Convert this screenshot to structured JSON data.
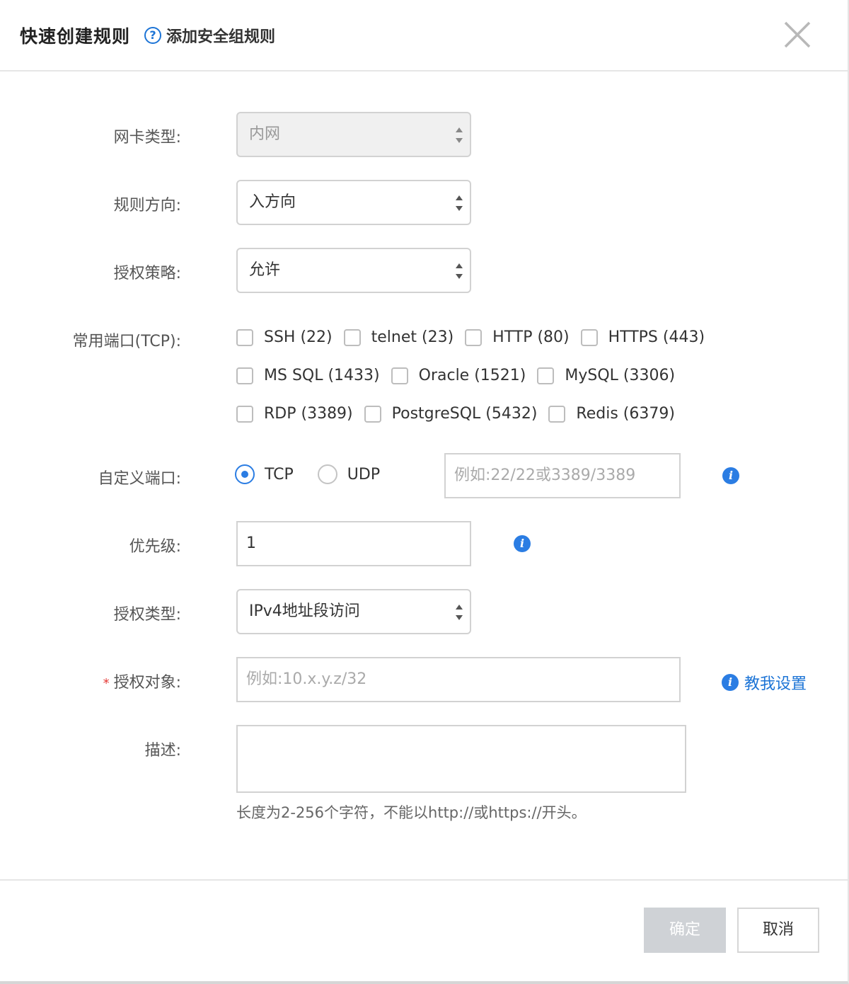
{
  "header": {
    "title": "快速创建规则",
    "help_text": "添加安全组规则"
  },
  "form": {
    "nic_type": {
      "label": "网卡类型:",
      "value": "内网",
      "disabled": true
    },
    "direction": {
      "label": "规则方向:",
      "value": "入方向"
    },
    "policy": {
      "label": "授权策略:",
      "value": "允许"
    },
    "common_ports": {
      "label": "常用端口(TCP):",
      "rows": [
        [
          "SSH (22)",
          "telnet (23)",
          "HTTP (80)",
          "HTTPS (443)"
        ],
        [
          "MS SQL (1433)",
          "Oracle (1521)",
          "MySQL (3306)"
        ],
        [
          "RDP (3389)",
          "PostgreSQL (5432)",
          "Redis (6379)"
        ]
      ]
    },
    "custom_port": {
      "label": "自定义端口:",
      "protocols": [
        "TCP",
        "UDP"
      ],
      "selected": "TCP",
      "placeholder": "例如:22/22或3389/3389"
    },
    "priority": {
      "label": "优先级:",
      "value": "1"
    },
    "auth_type": {
      "label": "授权类型:",
      "value": "IPv4地址段访问"
    },
    "auth_object": {
      "label": "授权对象:",
      "required_mark": "*",
      "placeholder": "例如:10.x.y.z/32",
      "help_link": "教我设置"
    },
    "description": {
      "label": "描述:",
      "hint": "长度为2-256个字符，不能以http://或https://开头。"
    }
  },
  "footer": {
    "ok_label": "确定",
    "cancel_label": "取消"
  },
  "colors": {
    "accent": "#2b7de3",
    "link": "#1c74d6",
    "required": "#e53935",
    "disabled_button": "#cfd2d6"
  },
  "icons": {
    "help": "question-circle-icon",
    "info": "info-circle-icon",
    "close": "close-icon",
    "select": "up-down-arrows-icon"
  }
}
